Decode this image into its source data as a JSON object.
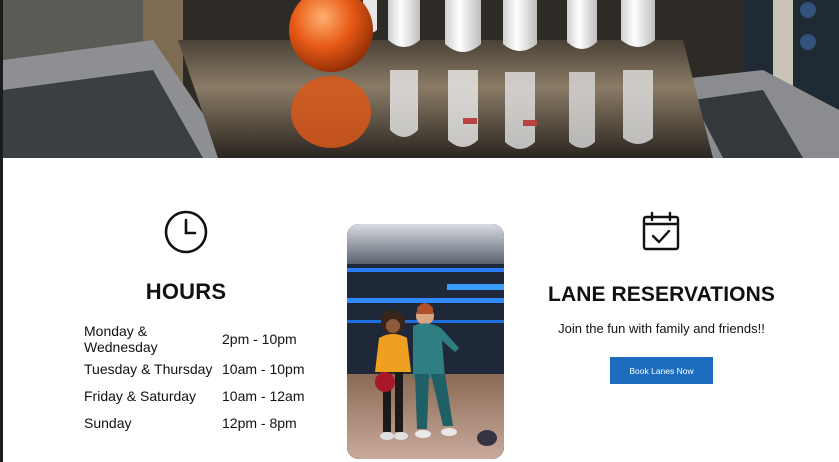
{
  "hours": {
    "title": "HOURS",
    "icon": "clock-icon",
    "rows": [
      {
        "days": "Monday & Wednesday",
        "time": "2pm - 10pm"
      },
      {
        "days": "Tuesday & Thursday",
        "time": "10am - 10pm"
      },
      {
        "days": "Friday & Saturday",
        "time": "10am - 12am"
      },
      {
        "days": "Sunday",
        "time": "12pm - 8pm"
      }
    ]
  },
  "reservations": {
    "title": "LANE RESERVATIONS",
    "icon": "calendar-check-icon",
    "subtitle": "Join the fun with family and friends!!",
    "button_label": "Book Lanes Now"
  },
  "colors": {
    "accent_button": "#1c6dc0",
    "text": "#111111",
    "background": "#ffffff"
  }
}
